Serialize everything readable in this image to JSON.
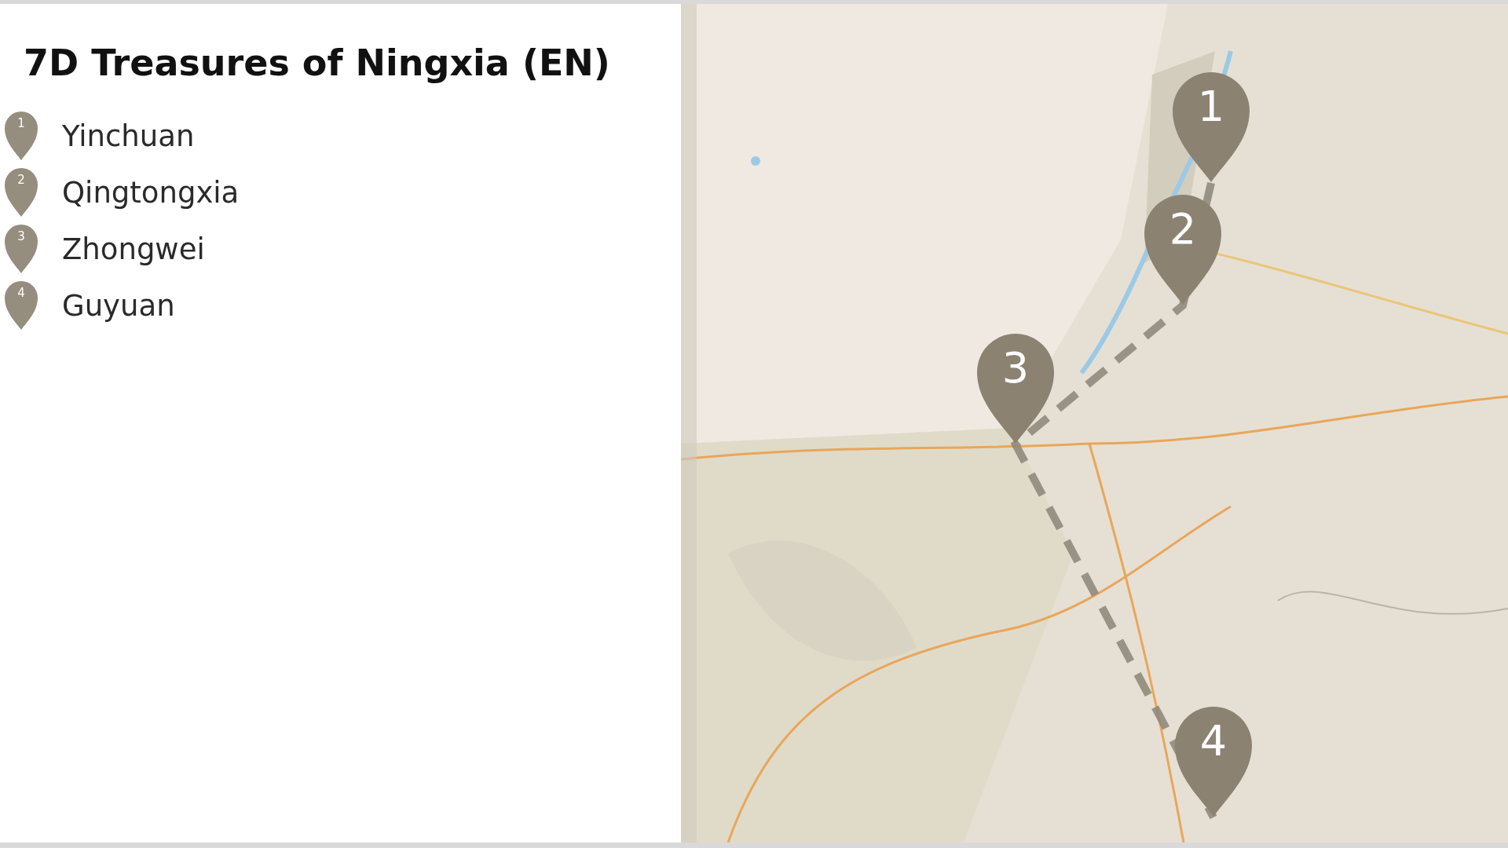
{
  "title": "7D Treasures of Ningxia (EN)",
  "stops": [
    {
      "number": "1",
      "name": "Yinchuan"
    },
    {
      "number": "2",
      "name": "Qingtongxia"
    },
    {
      "number": "3",
      "name": "Zhongwei"
    },
    {
      "number": "4",
      "name": "Guyuan"
    }
  ],
  "map": {
    "markers": [
      {
        "label": "1"
      },
      {
        "label": "2"
      },
      {
        "label": "3"
      },
      {
        "label": "4"
      }
    ]
  }
}
